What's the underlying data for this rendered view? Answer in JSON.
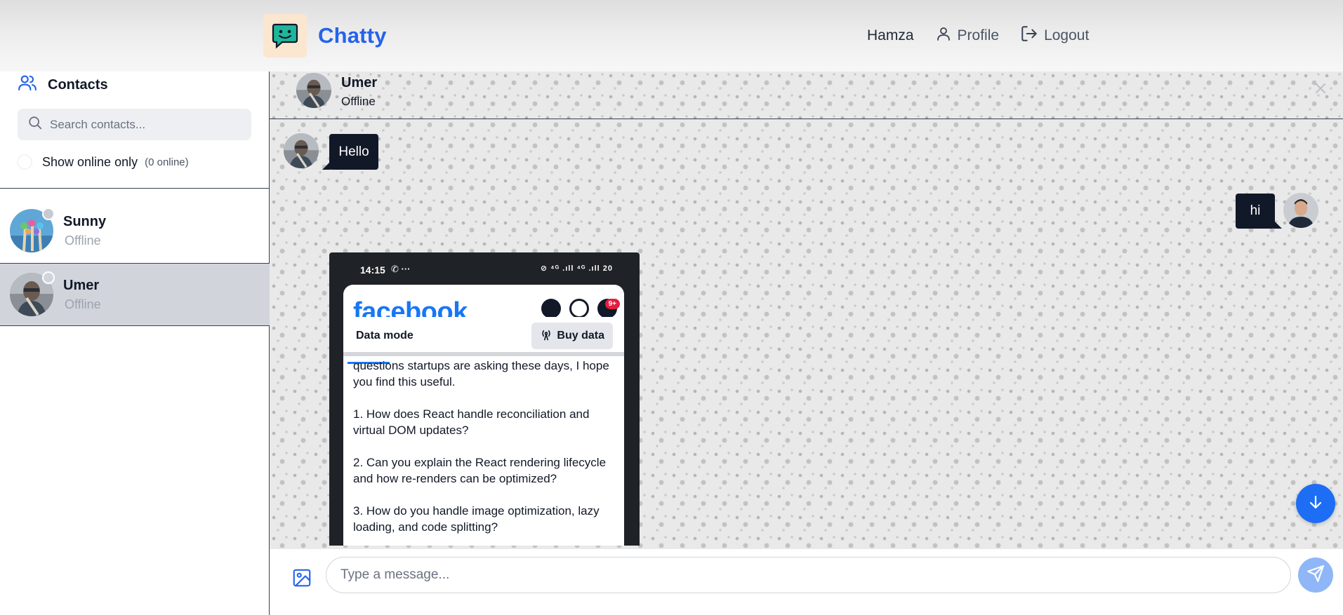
{
  "app": {
    "name": "Chatty",
    "logo_icon": "smiley-chat-icon"
  },
  "header": {
    "username": "Hamza",
    "profile_label": "Profile",
    "logout_label": "Logout"
  },
  "sidebar": {
    "title": "Contacts",
    "search_placeholder": "Search contacts...",
    "online_filter_label": "Show online only",
    "online_count": "(0 online)",
    "contacts": [
      {
        "name": "Sunny",
        "status": "Offline"
      },
      {
        "name": "Umer",
        "status": "Offline",
        "selected": true
      }
    ]
  },
  "chat": {
    "contact_name": "Umer",
    "contact_status": "Offline",
    "messages": [
      {
        "from": "Umer",
        "text": "Hello"
      },
      {
        "from": "me",
        "text": "hi"
      }
    ],
    "attachment": {
      "status_time": "14:15",
      "status_icons": "✆ ···",
      "status_right": "⊘ ⁴ᴳ .ıll ⁴ᴳ .ıll 20",
      "app_wordmark": "facebook",
      "notification_badge": "9+",
      "data_mode_label": "Data mode",
      "buy_data_label": "Buy data",
      "post_lines": [
        "questions startups are asking these days, I hope you find this useful.",
        "1. How does React handle reconciliation and virtual DOM updates?",
        "2. Can you explain the React rendering lifecycle and how re-renders can be optimized?",
        "3. How do you handle image optimization, lazy loading, and code splitting?"
      ]
    },
    "composer_placeholder": "Type a message..."
  },
  "colors": {
    "brand": "#2563eb",
    "bubble": "#111827",
    "scroll_button": "#1d6ef5",
    "send_button": "#8fb6f7"
  }
}
